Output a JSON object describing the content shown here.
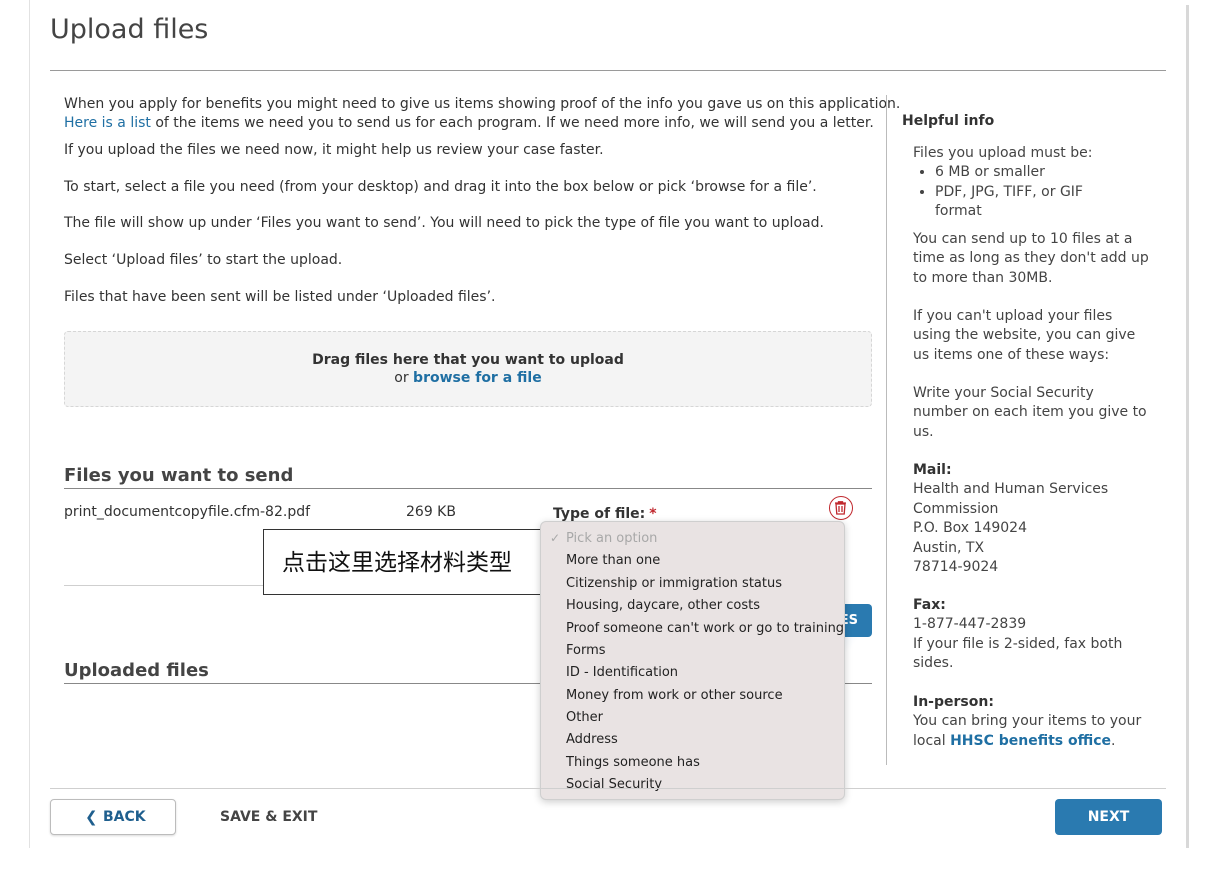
{
  "page": {
    "title": "Upload files"
  },
  "intro": {
    "p1_line1": "When you apply for benefits you might need to give us items showing proof of the info you gave us on this application.",
    "p1_link": "Here is a list",
    "p1_rest": " of the items we need you to send us for each program. If we need more info, we will send you a letter.",
    "p2": "If you upload the files we need now, it might help us review your case faster.",
    "p3": "To start, select a file you need (from your desktop) and drag it into the box below or pick ‘browse for a file’.",
    "p4": "The file will show up under ‘Files you want to send’. You will need to pick the type of file you want to upload.",
    "p5": "Select ‘Upload files’ to start the upload.",
    "p6": "Files that have been sent will be listed under ‘Uploaded files’."
  },
  "dropzone": {
    "main": "Drag files here that you want to upload",
    "or": "or ",
    "browse": "browse for a file"
  },
  "files_section": {
    "title": "Files you want to send",
    "file": {
      "name": "print_documentcopyfile.cfm-82.pdf",
      "size": "269 KB",
      "type_label": "Type of file:",
      "required_mark": "*"
    },
    "upload_button_fragment": "ES"
  },
  "uploaded_section": {
    "title": "Uploaded files"
  },
  "tooltip": {
    "text": "点击这里选择材料类型"
  },
  "dropdown": {
    "selected_mark": "✓",
    "options": [
      "Pick an option",
      "More than one",
      "Citizenship or immigration status",
      "Housing, daycare, other costs",
      "Proof someone can't work or go to training",
      "Forms",
      "ID - Identification",
      "Money from work or other source",
      "Other",
      "Address",
      "Things someone has",
      "Social Security"
    ]
  },
  "sidebar": {
    "title": "Helpful info",
    "must_be": "Files you upload must be:",
    "req1": "6 MB or smaller",
    "req2_l1": "PDF, JPG, TIFF, or GIF",
    "req2_l2": "format",
    "limit_l1": "You can send up to 10 files at a",
    "limit_l2": "time as long as they don't add up",
    "limit_l3": "to more than 30MB.",
    "alt_l1": "If you can't upload your files",
    "alt_l2": "using the website, you can give",
    "alt_l3": "us items one of these ways:",
    "ssn_l1": "Write your Social Security",
    "ssn_l2": "number on each item you give to",
    "ssn_l3": "us.",
    "mail_title": "Mail:",
    "mail_l1": "Health and Human Services",
    "mail_l2": "Commission",
    "mail_l3": "P.O. Box 149024",
    "mail_l4": "Austin, TX",
    "mail_l5": "78714-9024",
    "fax_title": "Fax:",
    "fax_number": "1-877-447-2839",
    "fax_l2": "If your file is 2-sided, fax both",
    "fax_l3": "sides.",
    "inperson_title": "In-person:",
    "inperson_l1": "You can bring your items to your",
    "inperson_local": "local ",
    "inperson_link": "HHSC benefits office",
    "inperson_end": "."
  },
  "footer": {
    "back_chevron": "❮",
    "back": "BACK",
    "save_exit": "SAVE & EXIT",
    "next": "NEXT"
  },
  "colors": {
    "accent": "#2a7ab0",
    "link": "#1f6fa3",
    "danger": "#c0272d"
  }
}
